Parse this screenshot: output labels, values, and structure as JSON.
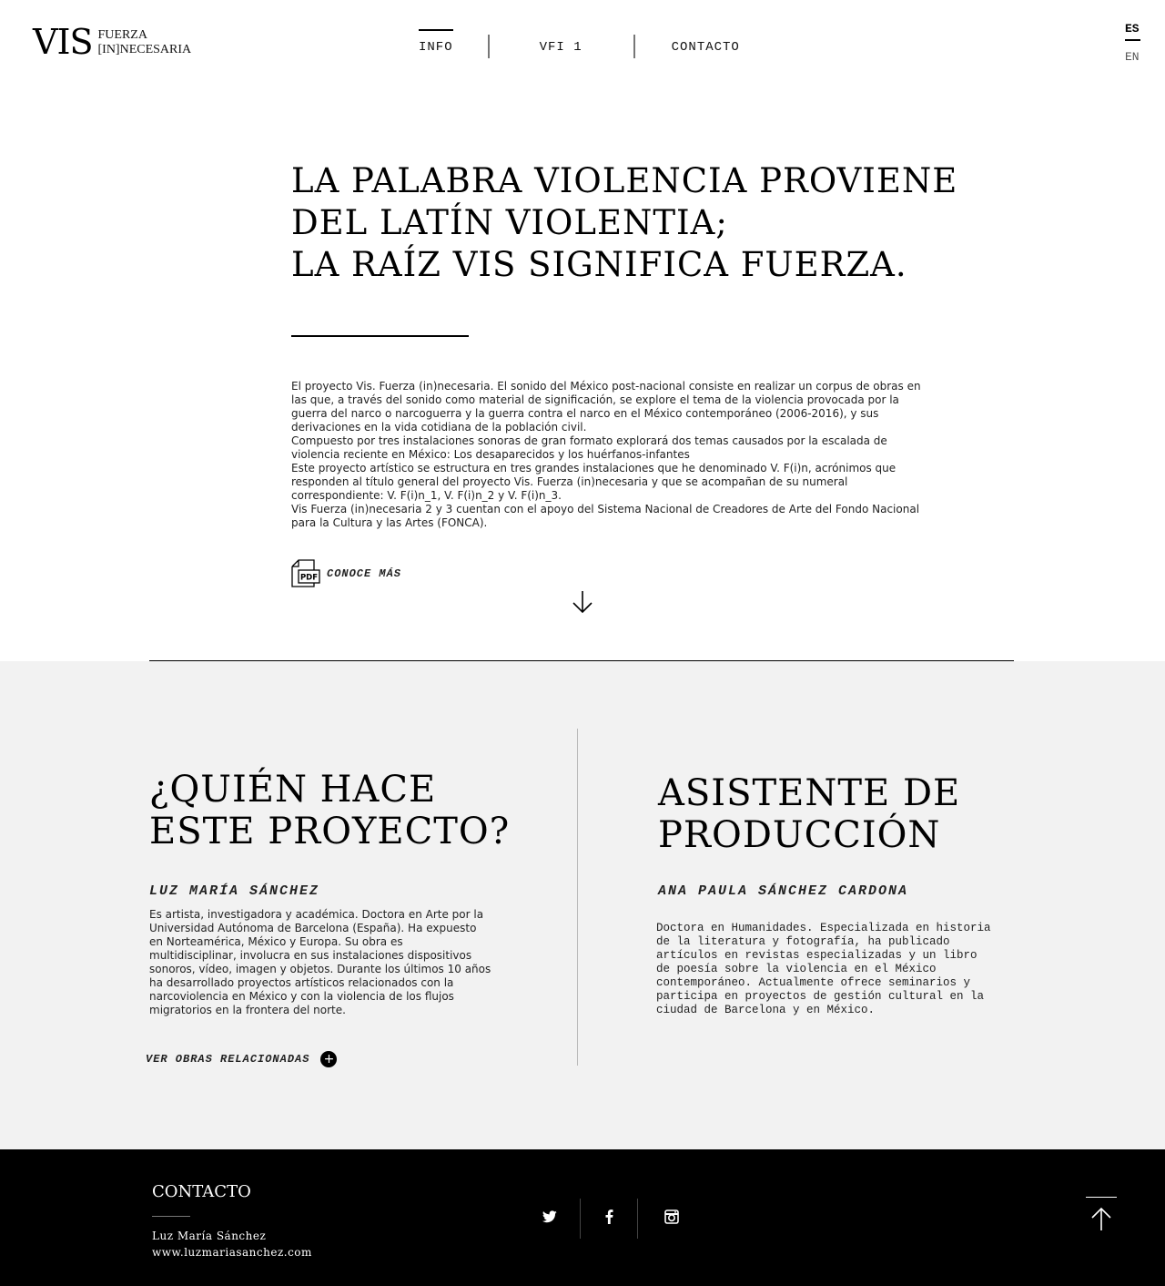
{
  "header": {
    "logo_main": "VIS",
    "logo_line1": "FUERZA",
    "logo_line2": "[IN]NECESARIA",
    "nav": [
      {
        "label": "INFO",
        "active": true
      },
      {
        "label": "VFI 1",
        "active": false
      },
      {
        "label": "CONTACTO",
        "active": false
      }
    ],
    "lang": {
      "es": "ES",
      "en": "EN",
      "selected": "ES"
    }
  },
  "hero": {
    "title_lines": [
      "LA PALABRA VIOLENCIA PROVIENE",
      "DEL LATÍN VIOLENTIA;",
      "LA RAÍZ VIS SIGNIFICA FUERZA."
    ],
    "paragraphs": [
      "El proyecto Vis. Fuerza (in)necesaria. El sonido del México post-nacional consiste en realizar un corpus de obras en las que, a través del sonido como material de significación, se explore el tema de la violencia provocada por la guerra del narco o narcoguerra y la guerra contra el narco en el México contemporáneo (2006-2016), y sus derivaciones en la vida cotidiana de la población civil.",
      "Compuesto por tres instalaciones sonoras de gran formato explorará dos temas causados por la escalada de violencia reciente en México: Los desaparecidos y los huérfanos-infantes",
      "Este proyecto artístico se estructura en tres grandes instalaciones que he denominado V. F(i)n, acrónimos que responden al título general del proyecto Vis. Fuerza (in)necesaria y que se acompañan de su numeral correspondiente: V. F(i)n_1, V. F(i)n_2 y V. F(i)n_3.",
      "Vis Fuerza (in)necesaria 2 y 3 cuentan con el apoyo del Sistema Nacional de Creadores de Arte del Fondo Nacional para la Cultura y las Artes (FONCA)."
    ],
    "pdf_badge": "PDF",
    "pdf_label": "CONOCE MÁS"
  },
  "team": {
    "left": {
      "heading_lines": [
        "¿QUIÉN HACE",
        "ESTE PROYECTO?"
      ],
      "name": "LUZ MARÍA SÁNCHEZ",
      "bio": "Es artista, investigadora y académica. Doctora en Arte por la Universidad Autónoma de Barcelona (España). Ha expuesto en Norteamérica, México y Europa. Su obra es multidisciplinar, involucra en sus instalaciones dispositivos sonoros, vídeo, imagen y objetos. Durante los últimos 10 años ha desarrollado proyectos artísticos relacionados con la narcoviolencia en México y con la violencia de los flujos migratorios en la frontera del norte.",
      "link_label": "VER OBRAS RELACIONADAS",
      "link_icon": "+"
    },
    "right": {
      "heading_lines": [
        "ASISTENTE DE",
        "PRODUCCIÓN"
      ],
      "name": "ANA PAULA SÁNCHEZ CARDONA",
      "bio": "Doctora en Humanidades. Especializada en historia de la  literatura y fotografía, ha publicado artículos en revistas especializadas y un libro de poesía sobre la violencia en el México contemporáneo. Actualmente ofrece seminarios y participa en proyectos de gestión cultural en la ciudad de Barcelona y en México."
    }
  },
  "footer": {
    "title": "CONTACTO",
    "name": "Luz María Sánchez",
    "website": "www.luzmariasanchez.com",
    "social": [
      "twitter-icon",
      "facebook-icon",
      "instagram-icon"
    ],
    "colors": {
      "background": "#000000",
      "text": "#ffffff",
      "section_bg": "#f2f2f2"
    }
  }
}
